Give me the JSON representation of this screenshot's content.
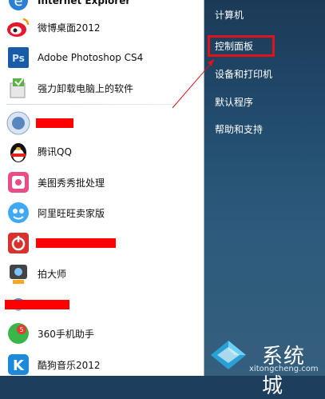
{
  "programs": [
    {
      "label": "Internet Explorer",
      "icon": "internet-explorer-icon"
    },
    {
      "label": "微博桌面2012",
      "icon": "weibo-icon"
    },
    {
      "label": "Adobe Photoshop CS4",
      "icon": "photoshop-icon"
    },
    {
      "label": "强力卸载电脑上的软件",
      "icon": "uninstaller-icon"
    },
    {
      "label": "",
      "icon": "app-icon"
    },
    {
      "label": "腾讯QQ",
      "icon": "qq-penguin-icon"
    },
    {
      "label": "美图秀秀批处理",
      "icon": "meitu-icon"
    },
    {
      "label": "阿里旺旺卖家版",
      "icon": "aliwangwang-icon"
    },
    {
      "label": "",
      "icon": "power-app-icon"
    },
    {
      "label": "拍大师",
      "icon": "paidashi-icon"
    },
    {
      "label": "",
      "icon": "app2-icon"
    },
    {
      "label": "360手机助手",
      "icon": "360-phone-icon"
    },
    {
      "label": "酷狗音乐2012",
      "icon": "kugou-icon"
    }
  ],
  "right_panel": {
    "items": [
      "计算机",
      "控制面板",
      "设备和打印机",
      "默认程序",
      "帮助和支持"
    ]
  },
  "watermark": {
    "text": "系统城",
    "url": "xitongcheng.com"
  },
  "colors": {
    "highlight": "#e0121b",
    "redaction": "#ff0000",
    "right_panel_bg": "#234d6f"
  }
}
